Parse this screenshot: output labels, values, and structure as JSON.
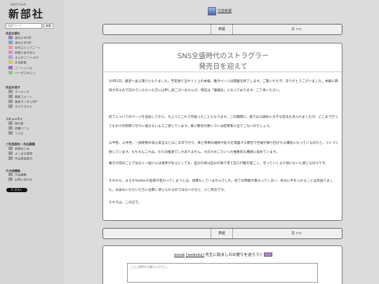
{
  "logo": {
    "sub": "NEETSHA",
    "main": "新部社"
  },
  "search": {
    "placeholder": "検索ワード",
    "button": "検索"
  },
  "sections": [
    {
      "title": "作品を読む",
      "items": [
        {
          "label": "週刊少年VIP",
          "color": "#9b7fc4"
        },
        {
          "label": "週刊少年VIP",
          "color": "#7fa3c9"
        },
        {
          "label": "月刊コミックニート",
          "color": "#e39b9b"
        },
        {
          "label": "新都少女きぼん",
          "color": "#d98fc4"
        },
        {
          "label": "まんがニートぶげ",
          "color": "#b6a0d4"
        },
        {
          "label": "文芸新都",
          "color": "#d9c56a"
        },
        {
          "label": "ニートノベル",
          "color": "#a46ac2"
        },
        {
          "label": "ベータマガジン",
          "color": "#8fc48f"
        }
      ]
    },
    {
      "title": "作品を探す",
      "items": [
        {
          "label": "ランキング",
          "color": "#9a9a9a"
        },
        {
          "label": "最新コメント",
          "color": "#9a9a9a"
        },
        {
          "label": "検索ランダムVIP",
          "color": "#9a9a9a"
        },
        {
          "label": "タグクラウド",
          "color": "#9a9a9a"
        }
      ]
    },
    {
      "title": "コミュニティ",
      "items": [
        {
          "label": "掲示板",
          "color": "#9a9a9a"
        },
        {
          "label": "読書ページ",
          "color": "#9a9a9a"
        },
        {
          "label": "うらだ",
          "color": "#9a9a9a"
        }
      ]
    },
    {
      "title": "ご利用案内・作品募集",
      "items": [
        {
          "label": "新都社とは",
          "color": "#9a9a9a"
        },
        {
          "label": "よくある質問",
          "color": "#9a9a9a"
        },
        {
          "label": "作品登録案内",
          "color": "#9a9a9a"
        }
      ]
    },
    {
      "title": "その他機能",
      "items": [
        {
          "label": "作品編集",
          "color": "#9a9a9a"
        },
        {
          "label": "お問い合わせ",
          "color": "#9a9a9a"
        }
      ]
    }
  ],
  "tweet_button": "ポスト",
  "brand": {
    "label": "文芸新都"
  },
  "nav": {
    "cover": "表紙",
    "next": "次 >>"
  },
  "article": {
    "title_line1": "SNS全盛時代のストラグラー",
    "title_line2": "発売日を迎えて",
    "paragraphs": [
      "10月2日。書店へ並ぶ運びとなりました。予定通り当サイト上の本編、番外ページは掲載を終了します。ご覧いただき、ありがとうございました。本編に興味があるので訪れていただいた方には申し訳ございませんが、現在は「書籍化」となっております。ご了承ください。",
      "校了についてのページを追加してから、ちょうどこれで月経ったことになります。この期間に、彼ではる微妙に大きな変化も見られましたが、どこまで行ってもかけの民間ぐ切りに通さないようご感じています。真に都合の悪いコトは結束者に出てこないのでしょう。",
      "公平性、公共性、一般便民の安心安全などはこの次でかり、真と判断の継続や拡大を意図する都合で世論が振り回される構造になっているのだと、つくづく感じています。もちろんこれは、ただの推測でしかありません。そのためこういった抽象的な構想に留めています。",
      "権力が前のことではなく一個人には限界があるとしても、自分の身は自分の限で考え自ら行動を起こし、守っていくより他にないと感じる日々です。",
      "それから、まさかTwitterの名称が変わってしまうとは、想像もしていませんでした。校了の時期が重なってしまい、本文に手を入れることは見送りました。お読みいただいた方に古典く感じられるのではないかなと、少し残念です。",
      "それでは、この辺で。"
    ]
  },
  "letter": {
    "author": "mook",
    "website": "[website]",
    "message": "先生に励ましのお便りを送ろう!!",
    "placeholder": "ここに感想をお書きください。"
  }
}
